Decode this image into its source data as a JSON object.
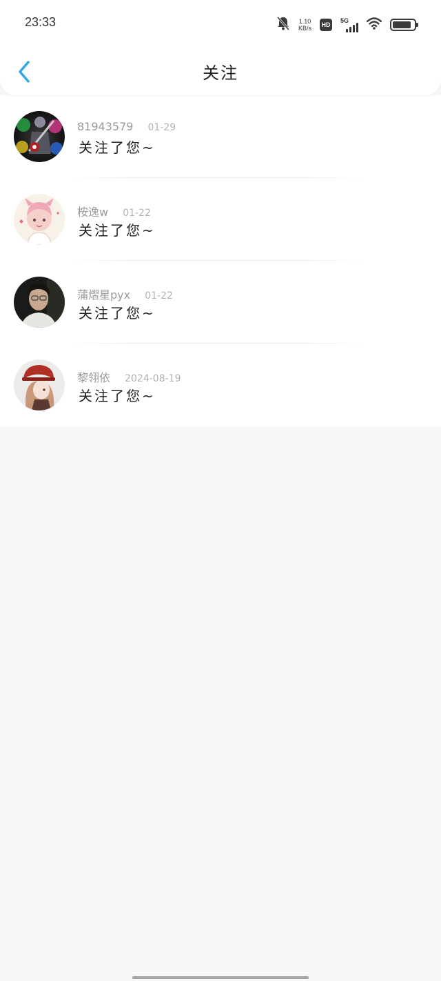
{
  "status_bar": {
    "time": "23:33",
    "net_speed_value": "1.10",
    "net_speed_unit": "KB/s",
    "hd_label": "HD",
    "network_label": "5G",
    "battery_level": 0.85
  },
  "nav": {
    "title": "关注"
  },
  "notifications": [
    {
      "name": "81943579",
      "date": "01-29",
      "message": "关注了您~",
      "avatar_icon": "avatar-figure-guitar"
    },
    {
      "name": "桉逸w",
      "date": "01-22",
      "message": "关注了您~",
      "avatar_icon": "avatar-anime-pink"
    },
    {
      "name": "蒲熠星pyx",
      "date": "01-22",
      "message": "关注了您~",
      "avatar_icon": "avatar-photo-person"
    },
    {
      "name": "黎翎依",
      "date": "2024-08-19",
      "message": "关注了您~",
      "avatar_icon": "avatar-anime-redhat"
    }
  ],
  "colors": {
    "accent": "#2ea7e0",
    "background": "#f8f6f7",
    "name_text": "#9a9a9a",
    "message_text": "#222222"
  }
}
